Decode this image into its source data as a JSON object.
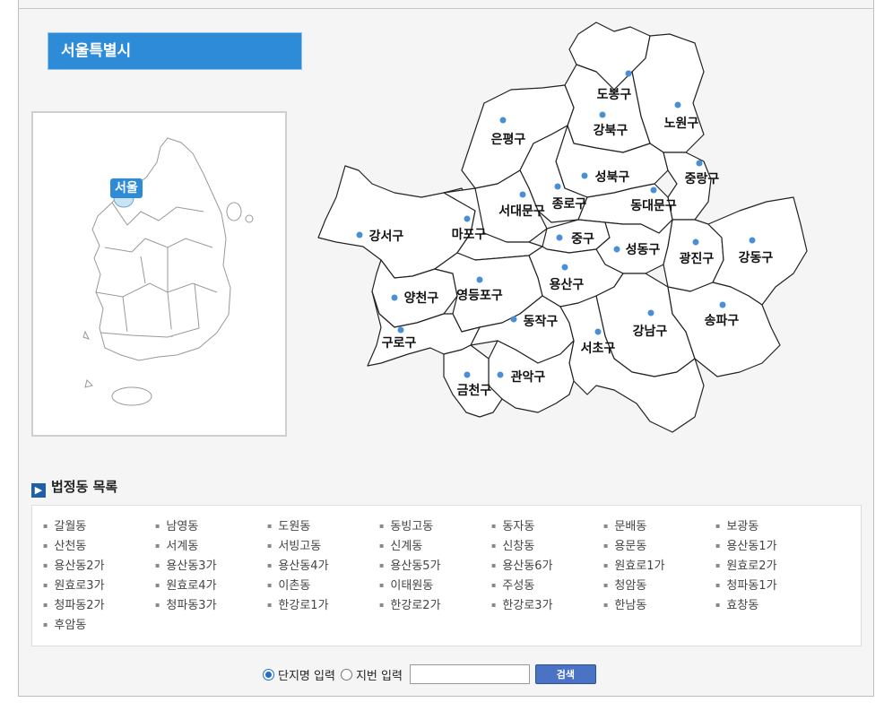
{
  "city_title": "서울특별시",
  "mini_map_label": "서울",
  "districts": [
    {
      "name": "도봉구"
    },
    {
      "name": "노원구"
    },
    {
      "name": "강북구"
    },
    {
      "name": "은평구"
    },
    {
      "name": "성북구"
    },
    {
      "name": "중랑구"
    },
    {
      "name": "종로구"
    },
    {
      "name": "서대문구"
    },
    {
      "name": "동대문구"
    },
    {
      "name": "강서구"
    },
    {
      "name": "마포구"
    },
    {
      "name": "중구"
    },
    {
      "name": "성동구"
    },
    {
      "name": "광진구"
    },
    {
      "name": "강동구"
    },
    {
      "name": "용산구"
    },
    {
      "name": "양천구"
    },
    {
      "name": "영등포구"
    },
    {
      "name": "동작구"
    },
    {
      "name": "구로구"
    },
    {
      "name": "강남구"
    },
    {
      "name": "송파구"
    },
    {
      "name": "서초구"
    },
    {
      "name": "관악구"
    },
    {
      "name": "금천구"
    }
  ],
  "dong_list_title": "법정동 목록",
  "dong_list": [
    "갈월동",
    "남영동",
    "도원동",
    "동빙고동",
    "동자동",
    "문배동",
    "보광동",
    "산천동",
    "서계동",
    "서빙고동",
    "신계동",
    "신창동",
    "용문동",
    "용산동1가",
    "용산동2가",
    "용산동3가",
    "용산동4가",
    "용산동5가",
    "용산동6가",
    "원효로1가",
    "원효로2가",
    "원효로3가",
    "원효로4가",
    "이촌동",
    "이태원동",
    "주성동",
    "청암동",
    "청파동1가",
    "청파동2가",
    "청파동3가",
    "한강로1가",
    "한강로2가",
    "한강로3가",
    "한남동",
    "효창동",
    "후암동"
  ],
  "search": {
    "option1": "단지명 입력",
    "option2": "지번 입력",
    "selected": "단지명 입력",
    "input_value": "",
    "button_label": "검색"
  },
  "colors": {
    "accent": "#2d8bd8",
    "dot": "#4a8fd6",
    "button": "#4a73c6"
  }
}
